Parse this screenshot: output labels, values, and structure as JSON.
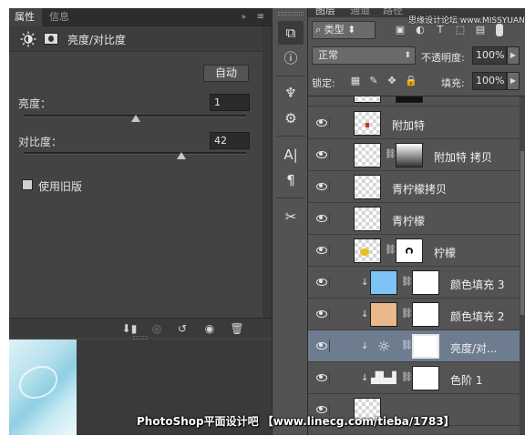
{
  "properties_panel": {
    "tabs": [
      "属性",
      "信息"
    ],
    "tab_close": "x",
    "collapse_icon": "»",
    "menu_icon": "≡",
    "title": "亮度/对比度",
    "auto_button": "自动",
    "brightness": {
      "label": "亮度：",
      "value": "1",
      "slider_fraction": 0.505
    },
    "contrast": {
      "label": "对比度：",
      "value": "42",
      "slider_fraction": 0.71
    },
    "legacy_checkbox": {
      "label": "使用旧版",
      "checked": false
    },
    "footer_icons": [
      "clip-to-layer-icon",
      "view-previous-icon",
      "reset-icon",
      "visibility-icon",
      "delete-icon"
    ]
  },
  "toolbar": {
    "tools": [
      "3d-icon",
      "info-icon",
      "brush-presets-icon",
      "adjust-icon",
      "character-icon",
      "paragraph-icon",
      "tool-presets-icon"
    ],
    "glyphs": [
      "⧉",
      "ⓘ",
      "♆",
      "⚙",
      "A|",
      "¶",
      "✂"
    ]
  },
  "layers_panel": {
    "tabs": [
      "图层",
      "通道",
      "路径"
    ],
    "filter_kind": "类型",
    "blend_mode": "正常",
    "opacity_label": "不透明度:",
    "opacity_value": "100%",
    "lock_label": "锁定:",
    "fill_label": "填充:",
    "fill_value": "100%",
    "layers": [
      {
        "name": "",
        "thumb": "checker",
        "mask": "black"
      },
      {
        "name": "附加特",
        "thumb": "checker-red",
        "mask": null
      },
      {
        "name": "附加特 拷贝",
        "thumb": "checker",
        "mask": "gradient"
      },
      {
        "name": "青柠檬拷贝",
        "thumb": "checker",
        "mask": null
      },
      {
        "name": "青柠檬",
        "thumb": "checker",
        "mask": null
      },
      {
        "name": "柠檬",
        "thumb": "checker-yellow",
        "mask": "white-shape"
      },
      {
        "name": "颜色填充 3",
        "thumb": "#7ec3f5",
        "mask": "white",
        "clipped": true
      },
      {
        "name": "颜色填充 2",
        "thumb": "#e9b98b",
        "mask": "white",
        "clipped": true
      },
      {
        "name": "亮度/对...",
        "thumb": "brightness-icon",
        "mask": "white",
        "clipped": true,
        "selected": true
      },
      {
        "name": "色阶 1",
        "thumb": "levels-icon",
        "mask": "white",
        "clipped": true
      },
      {
        "name": "",
        "thumb": "checker",
        "mask": null
      }
    ]
  },
  "watermark": {
    "bottom": "PhotoShop平面设计吧 【www.linecg.com/tieba/1783】",
    "top": "思缘设计论坛 www.MISSYUAN.COM"
  }
}
